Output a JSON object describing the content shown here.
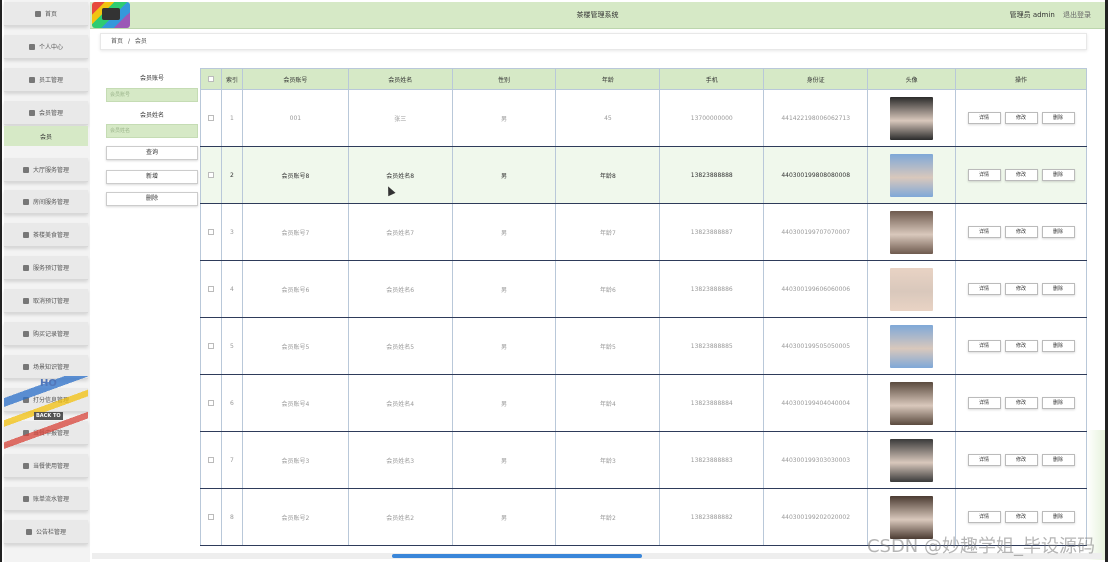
{
  "header": {
    "app_title": "茶楼管理系统",
    "user_label": "管理员 admin",
    "logout": "退出登录"
  },
  "sidebar": {
    "items": [
      {
        "label": "首页",
        "icon": "home-icon"
      },
      {
        "label": "个人中心",
        "icon": "user-icon"
      },
      {
        "label": "员工管理",
        "icon": "list-icon"
      },
      {
        "label": "会员管理",
        "icon": "grid-icon"
      },
      {
        "label": "大厅服务管理",
        "icon": "grid-icon"
      },
      {
        "label": "房间服务管理",
        "icon": "grid-icon"
      },
      {
        "label": "茶楼美食管理",
        "icon": "chat-icon"
      },
      {
        "label": "服务预订管理",
        "icon": "box-icon"
      },
      {
        "label": "取消预订管理",
        "icon": "chat-icon"
      },
      {
        "label": "购买记录管理",
        "icon": "grid-icon"
      },
      {
        "label": "场景知识管理",
        "icon": "send-icon"
      },
      {
        "label": "打分信息管理",
        "icon": "grid-icon"
      },
      {
        "label": "当餐申报管理",
        "icon": "grid-icon"
      },
      {
        "label": "当餐使用管理",
        "icon": "grid-icon"
      },
      {
        "label": "账单流水管理",
        "icon": "grid-icon"
      },
      {
        "label": "公告栏管理",
        "icon": "chart-icon"
      }
    ],
    "active_sub": "会员"
  },
  "breadcrumb": {
    "home": "首页",
    "sep": "/",
    "current": "会员"
  },
  "search": {
    "account_label": "会员账号",
    "account_placeholder": "会员账号",
    "name_label": "会员姓名",
    "name_placeholder": "会员姓名",
    "query_btn": "查询",
    "add_btn": "新增",
    "delete_btn": "删除"
  },
  "table": {
    "headers": [
      "索引",
      "会员账号",
      "会员姓名",
      "性别",
      "年龄",
      "手机",
      "身份证",
      "头像",
      "操作"
    ],
    "ops": {
      "detail": "详情",
      "edit": "修改",
      "delete": "删除"
    },
    "rows": [
      {
        "idx": "1",
        "account": "001",
        "name": "张三",
        "gender": "男",
        "age": "45",
        "phone": "13700000000",
        "id": "441422198006062713",
        "avatar_color": "#2b2b2b"
      },
      {
        "idx": "2",
        "account": "会员账号8",
        "name": "会员姓名8",
        "gender": "男",
        "age": "年龄8",
        "phone": "13823888888",
        "id": "440300199808080008",
        "avatar_color": "#7fa8d8"
      },
      {
        "idx": "3",
        "account": "会员账号7",
        "name": "会员姓名7",
        "gender": "男",
        "age": "年龄7",
        "phone": "13823888887",
        "id": "440300199707070007",
        "avatar_color": "#6e5a4e"
      },
      {
        "idx": "4",
        "account": "会员账号6",
        "name": "会员姓名6",
        "gender": "男",
        "age": "年龄6",
        "phone": "13823888886",
        "id": "440300199606060006",
        "avatar_color": "#e9d3c4"
      },
      {
        "idx": "5",
        "account": "会员账号5",
        "name": "会员姓名5",
        "gender": "男",
        "age": "年龄5",
        "phone": "13823888885",
        "id": "440300199505050005",
        "avatar_color": "#7fa8d8"
      },
      {
        "idx": "6",
        "account": "会员账号4",
        "name": "会员姓名4",
        "gender": "男",
        "age": "年龄4",
        "phone": "13823888884",
        "id": "440300199404040004",
        "avatar_color": "#5a4a3e"
      },
      {
        "idx": "7",
        "account": "会员账号3",
        "name": "会员姓名3",
        "gender": "男",
        "age": "年龄3",
        "phone": "13823888883",
        "id": "440300199303030003",
        "avatar_color": "#3a3a3a"
      },
      {
        "idx": "8",
        "account": "会员账号2",
        "name": "会员姓名2",
        "gender": "男",
        "age": "年龄2",
        "phone": "13823888882",
        "id": "440300199202020002",
        "avatar_color": "#4b3b32"
      }
    ]
  },
  "watermark": "CSDN @妙趣学姐_毕设源码",
  "overlay_text": {
    "a": "HO",
    "b": "BACK TO"
  }
}
